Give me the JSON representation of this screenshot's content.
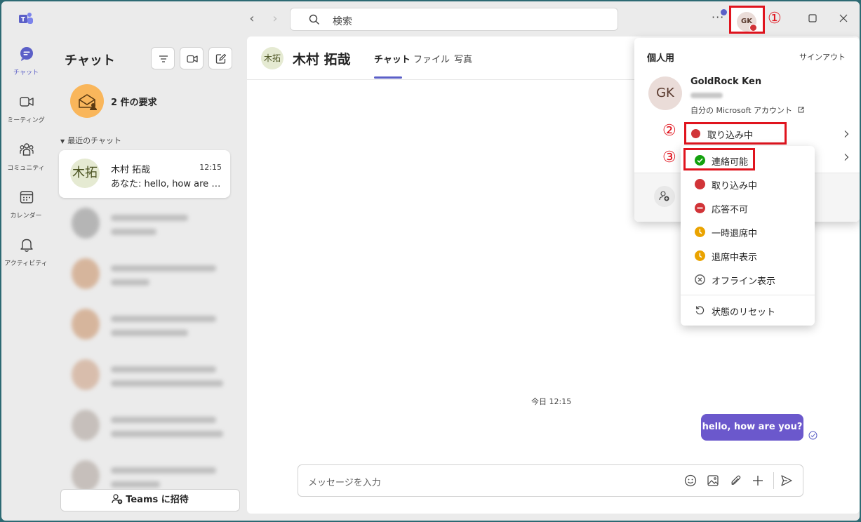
{
  "titlebar": {
    "search_placeholder": "検索",
    "more": "···",
    "avatar_initials": "GK",
    "annotation_1": "①"
  },
  "rail": {
    "items": [
      {
        "label": "チャット"
      },
      {
        "label": "ミーティング"
      },
      {
        "label": "コミュニティ"
      },
      {
        "label": "カレンダー"
      },
      {
        "label": "アクティビティ"
      }
    ]
  },
  "chatlist": {
    "title": "チャット",
    "requests": "2 件の要求",
    "recent_label": "最近のチャット",
    "active_chat": {
      "avatar": "木拓",
      "name": "木村 拓哉",
      "time": "12:15",
      "preview": "あなた: hello, how are you?"
    },
    "invite_label": "Teams に招待"
  },
  "main": {
    "header": {
      "avatar": "木拓",
      "name": "木村 拓哉",
      "tabs": [
        "チャット",
        "ファイル",
        "写真"
      ]
    },
    "date_separator": "今日 12:15",
    "message": "hello, how are you?",
    "composer_placeholder": "メッセージを入力"
  },
  "flyout": {
    "title": "個人用",
    "signout": "サインアウト",
    "avatar": "GK",
    "name": "GoldRock Ken",
    "msa_link": "自分の Microsoft アカウント",
    "current_status": "取り込み中",
    "annotation_2": "②",
    "annotation_3": "③"
  },
  "status_menu": {
    "items": [
      {
        "label": "連絡可能",
        "color": "#13a10e"
      },
      {
        "label": "取り込み中",
        "color": "#d13438"
      },
      {
        "label": "応答不可",
        "color": "#d13438"
      },
      {
        "label": "一時退席中",
        "color": "#eaa300"
      },
      {
        "label": "退席中表示",
        "color": "#eaa300"
      },
      {
        "label": "オフライン表示",
        "color": "#616161"
      },
      {
        "label": "状態のリセット",
        "color": "#424242"
      }
    ]
  }
}
